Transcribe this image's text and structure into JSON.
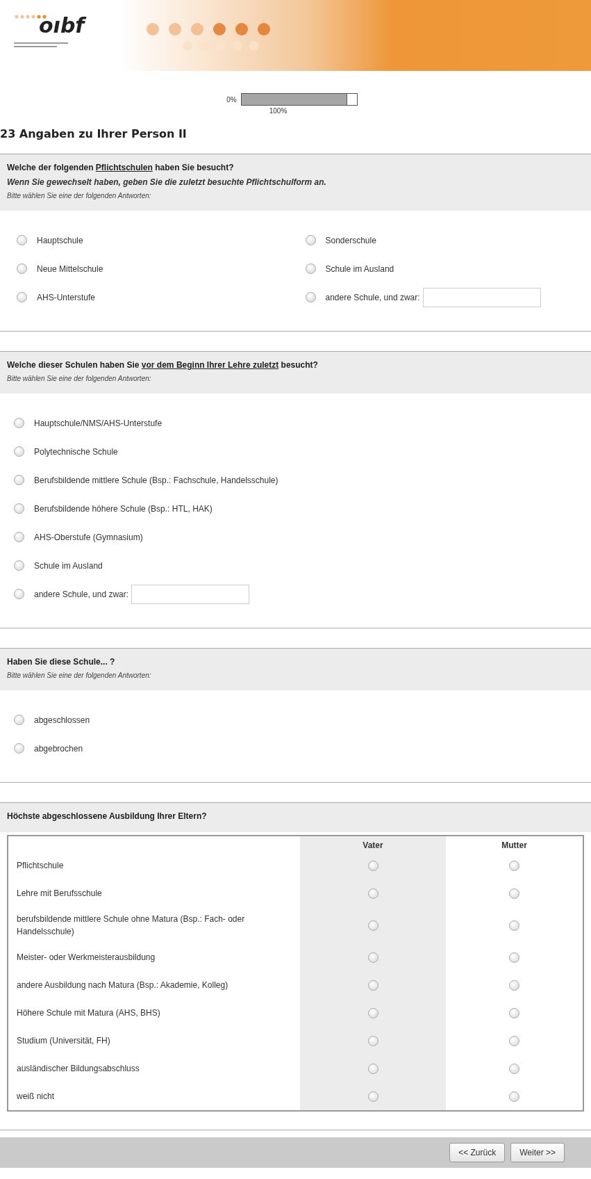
{
  "logo": {
    "text": "oıbf"
  },
  "progress": {
    "start": "0%",
    "end": "100%",
    "level": 0.92
  },
  "page_title": "23 Angaben zu Ihrer Person II",
  "questions": [
    {
      "kind": "choice_two_column",
      "question": [
        {
          "text": "Welche der folgenden "
        },
        {
          "text": "Pflichtschulen",
          "underline": true
        },
        {
          "text": " haben Sie besucht?"
        }
      ],
      "note": "Wenn Sie gewechselt haben, geben Sie die zuletzt besuchte Pflichtschulform an.",
      "hint": "Bitte wählen Sie eine der folgenden Antworten:",
      "options": [
        {
          "label": "Hauptschule",
          "selected": false,
          "kind": "plain"
        },
        {
          "label": "Neue Mittelschule",
          "selected": false,
          "kind": "plain"
        },
        {
          "label": "AHS-Unterstufe",
          "selected": false,
          "kind": "plain"
        },
        {
          "label": "Sonderschule",
          "selected": false,
          "kind": "plain"
        },
        {
          "label": "Schule im Ausland",
          "selected": false,
          "kind": "plain"
        },
        {
          "label": "andere Schule, und zwar:",
          "selected": false,
          "kind": "other"
        }
      ]
    },
    {
      "kind": "choice",
      "question": [
        {
          "text": "Welche dieser Schulen haben Sie "
        },
        {
          "text": "vor dem Beginn Ihrer Lehre zuletzt",
          "underline": true
        },
        {
          "text": " besucht?"
        }
      ],
      "hint": "Bitte wählen Sie eine der folgenden Antworten:",
      "options": [
        {
          "label": "Hauptschule/NMS/AHS-Unterstufe",
          "selected": false,
          "kind": "plain"
        },
        {
          "label": "Polytechnische Schule",
          "selected": false,
          "kind": "plain"
        },
        {
          "label": "Berufsbildende mittlere Schule (Bsp.: Fachschule, Handelsschule)",
          "selected": false,
          "kind": "plain"
        },
        {
          "label": "Berufsbildende höhere Schule (Bsp.: HTL, HAK)",
          "selected": false,
          "kind": "plain"
        },
        {
          "label": "AHS-Oberstufe (Gymnasium)",
          "selected": false,
          "kind": "plain"
        },
        {
          "label": "Schule im Ausland",
          "selected": false,
          "kind": "plain"
        },
        {
          "label": "andere Schule, und zwar:",
          "selected": false,
          "kind": "other"
        }
      ]
    },
    {
      "kind": "choice",
      "question": [
        {
          "text": "Haben Sie diese Schule... ?"
        }
      ],
      "hint": "Bitte wählen Sie eine der folgenden Antworten:",
      "options": [
        {
          "label": "abgeschlossen",
          "selected": false,
          "kind": "plain"
        },
        {
          "label": "abgebrochen",
          "selected": false,
          "kind": "plain"
        }
      ]
    },
    {
      "kind": "matrix",
      "question": [
        {
          "text": "Höchste abgeschlossene Ausbildung Ihrer Eltern?"
        }
      ],
      "columns": [
        "Vater",
        "Mutter"
      ],
      "rows": [
        {
          "label": "Pflichtschule",
          "cells": [
            {
              "selected": false
            },
            {
              "selected": false
            }
          ]
        },
        {
          "label": "Lehre mit Berufsschule",
          "cells": [
            {
              "selected": false
            },
            {
              "selected": false
            }
          ]
        },
        {
          "label": "berufsbildende mittlere Schule ohne Matura (Bsp.: Fach- oder Handelsschule)",
          "cells": [
            {
              "selected": false
            },
            {
              "selected": false
            }
          ]
        },
        {
          "label": "Meister- oder Werkmeisterausbildung",
          "cells": [
            {
              "selected": false
            },
            {
              "selected": false
            }
          ]
        },
        {
          "label": "andere Ausbildung nach Matura (Bsp.: Akademie, Kolleg)",
          "cells": [
            {
              "selected": false
            },
            {
              "selected": false
            }
          ]
        },
        {
          "label": "Höhere Schule mit Matura (AHS, BHS)",
          "cells": [
            {
              "selected": false
            },
            {
              "selected": false
            }
          ]
        },
        {
          "label": "Studium (Universität, FH)",
          "cells": [
            {
              "selected": false
            },
            {
              "selected": false
            }
          ]
        },
        {
          "label": "ausländischer Bildungsabschluss",
          "cells": [
            {
              "selected": false
            },
            {
              "selected": false
            }
          ]
        },
        {
          "label": "weiß nicht",
          "cells": [
            {
              "selected": false
            },
            {
              "selected": false
            }
          ]
        }
      ]
    }
  ],
  "buttons": [
    "<< Zurück",
    "Weiter >>"
  ]
}
